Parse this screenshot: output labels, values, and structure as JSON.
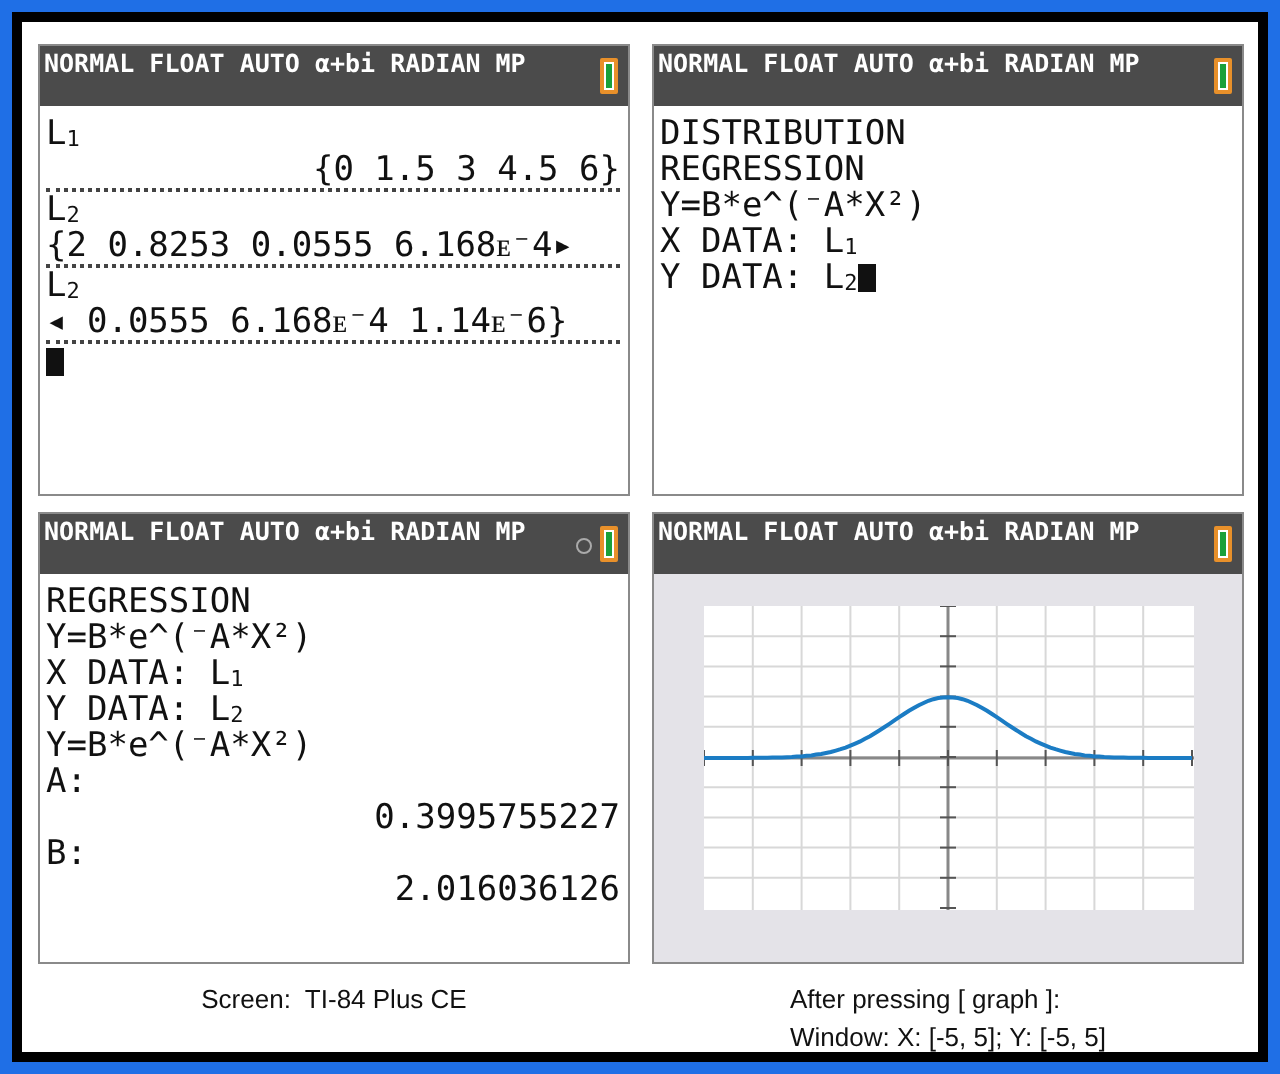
{
  "screens": [
    {
      "kind": "text",
      "status": "NORMAL FLOAT AUTO α+bi RADIAN MP",
      "busy": false,
      "lines": [
        {
          "text": "L$_{1}$",
          "right_aligned": false,
          "divider": false,
          "cursor": false
        },
        {
          "text": "{0 1.5 3 4.5 6}",
          "right_aligned": true,
          "divider": true,
          "cursor": false
        },
        {
          "text": "L$_{2}$",
          "right_aligned": false,
          "divider": false,
          "cursor": false
        },
        {
          "text": "{2 0.8253 0.0555 6.168ᴇ⁻4▸",
          "right_aligned": false,
          "divider": true,
          "cursor": false
        },
        {
          "text": "L$_{2}$",
          "right_aligned": false,
          "divider": false,
          "cursor": false
        },
        {
          "text": "◂ 0.0555 6.168ᴇ⁻4 1.14ᴇ⁻6}",
          "right_aligned": false,
          "divider": true,
          "cursor": false
        },
        {
          "right_aligned": false,
          "divider": false,
          "cursor": true
        }
      ]
    },
    {
      "kind": "text",
      "status": "NORMAL FLOAT AUTO α+bi RADIAN MP",
      "busy": false,
      "lines": [
        {
          "text": "DISTRIBUTION",
          "right_aligned": false,
          "divider": false,
          "cursor": false
        },
        {
          "text": "REGRESSION",
          "right_aligned": false,
          "divider": false,
          "cursor": false
        },
        {
          "text": "Y=B*e^(⁻A*X²)",
          "right_aligned": false,
          "divider": false,
          "cursor": false
        },
        {
          "text": "X DATA: L$_{1}$",
          "right_aligned": false,
          "divider": false,
          "cursor": false
        },
        {
          "text": "Y DATA: L$_{2}$",
          "right_aligned": false,
          "divider": false,
          "cursor": true
        }
      ]
    },
    {
      "kind": "text",
      "status": "NORMAL FLOAT AUTO α+bi RADIAN MP",
      "busy": true,
      "lines": [
        {
          "text": "REGRESSION",
          "right_aligned": false,
          "divider": false,
          "cursor": false
        },
        {
          "text": "Y=B*e^(⁻A*X²)",
          "right_aligned": false,
          "divider": false,
          "cursor": false
        },
        {
          "text": "X DATA: L$_{1}$",
          "right_aligned": false,
          "divider": false,
          "cursor": false
        },
        {
          "text": "Y DATA: L$_{2}$",
          "right_aligned": false,
          "divider": false,
          "cursor": false
        },
        {
          "text": "Y=B*e^(⁻A*X²)",
          "right_aligned": false,
          "divider": false,
          "cursor": false
        },
        {
          "text": "A:",
          "right_aligned": false,
          "divider": false,
          "cursor": false
        },
        {
          "text": "0.3995755227",
          "right_aligned": true,
          "divider": false,
          "cursor": false
        },
        {
          "text": "B:",
          "right_aligned": false,
          "divider": false,
          "cursor": false
        },
        {
          "text": "2.016036126",
          "right_aligned": true,
          "divider": false,
          "cursor": false
        }
      ],
      "caption": [
        "Screen:  TI-84 Plus CE"
      ]
    },
    {
      "kind": "graph",
      "status": "NORMAL FLOAT AUTO α+bi RADIAN MP",
      "busy": false,
      "caption": [
        "After pressing [ graph ]:",
        "Window: X: [-5, 5]; Y: [-5, 5]"
      ]
    }
  ]
}
